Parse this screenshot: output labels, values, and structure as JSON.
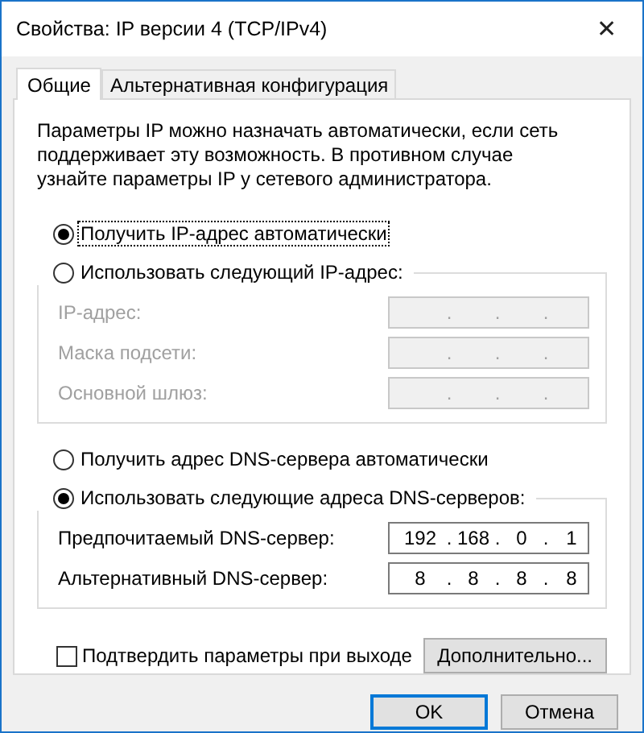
{
  "window": {
    "title": "Свойства: IP версии 4 (TCP/IPv4)",
    "close": "✕"
  },
  "tabs": [
    {
      "label": "Общие",
      "selected": true
    },
    {
      "label": "Альтернативная конфигурация",
      "selected": false
    }
  ],
  "description": "Параметры IP можно назначать автоматически, если сеть поддерживает эту возможность. В противном случае узнайте параметры IP у сетевого администратора.",
  "ip_auto": {
    "label": "Получить IP-адрес автоматически",
    "selected": true,
    "focused": true
  },
  "ip_manual": {
    "label": "Использовать следующий IP-адрес:",
    "selected": false,
    "focused": false,
    "fields": [
      {
        "label": "IP-адрес:",
        "disabled": true,
        "dots": [
          ".",
          ".",
          "."
        ]
      },
      {
        "label": "Маска подсети:",
        "disabled": true,
        "dots": [
          ".",
          ".",
          "."
        ]
      },
      {
        "label": "Основной шлюз:",
        "disabled": true,
        "dots": [
          ".",
          ".",
          "."
        ]
      }
    ]
  },
  "dns_auto": {
    "label": "Получить адрес DNS-сервера автоматически",
    "selected": false,
    "focused": false
  },
  "dns_manual": {
    "label": "Использовать следующие адреса DNS-серверов:",
    "selected": true,
    "focused": false,
    "fields": [
      {
        "label": "Предпочитаемый DNS-сервер:",
        "disabled": false,
        "dots": [
          ".",
          ".",
          "."
        ],
        "octets": [
          "192",
          "168",
          "0",
          "1"
        ]
      },
      {
        "label": "Альтернативный DNS-сервер:",
        "disabled": false,
        "dots": [
          ".",
          ".",
          "."
        ],
        "octets": [
          "8",
          "8",
          "8",
          "8"
        ]
      }
    ]
  },
  "validate": {
    "label": "Подтвердить параметры при выходе",
    "checked": false
  },
  "advanced_button": "Дополнительно...",
  "buttons": [
    {
      "label": "OK",
      "default": true
    },
    {
      "label": "Отмена",
      "default": false
    }
  ]
}
